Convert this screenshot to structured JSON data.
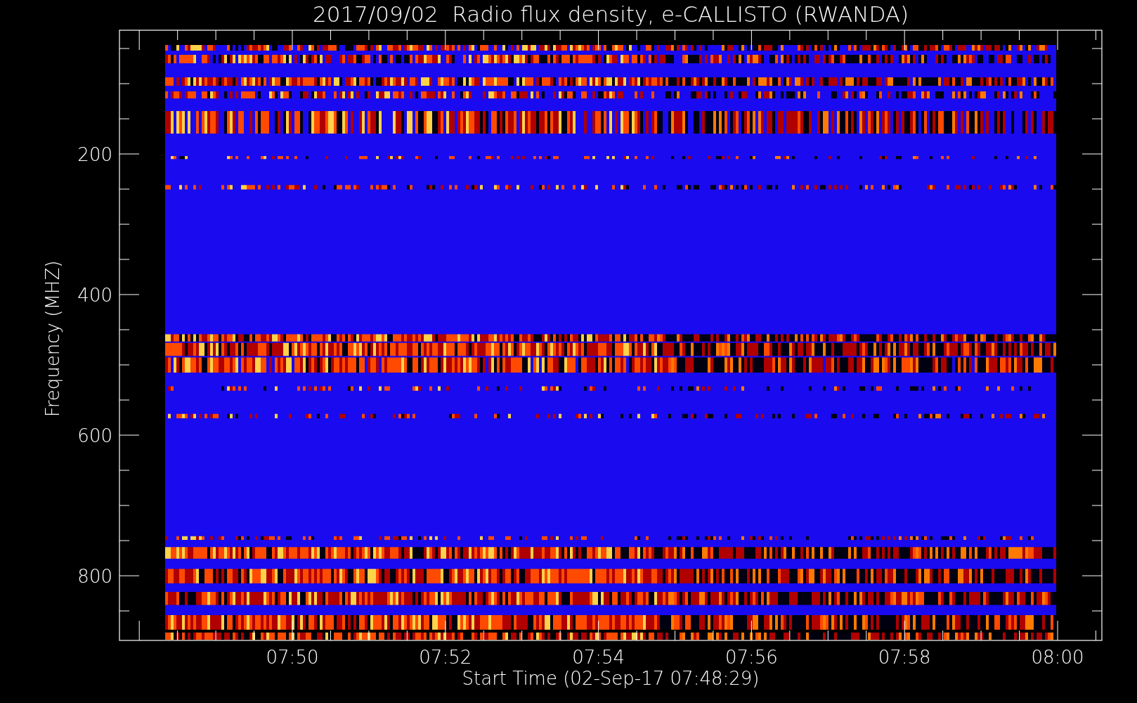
{
  "title": "2017/09/02  Radio flux density, e-CALLISTO (RWANDA)",
  "y_axis": {
    "label": "Frequency (MHZ)",
    "ticks": [
      "200",
      "400",
      "600",
      "800"
    ]
  },
  "x_axis": {
    "label": "Start Time (02-Sep-17 07:48:29)",
    "ticks": [
      "07:50",
      "07:52",
      "07:54",
      "07:56",
      "07:58",
      "08:00"
    ]
  }
}
